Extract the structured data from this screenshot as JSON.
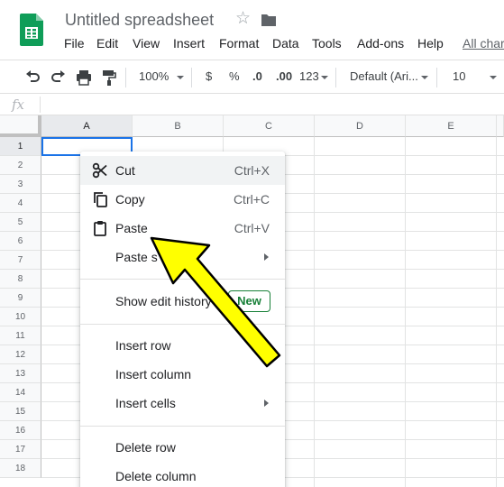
{
  "app": {
    "doc_title": "Untitled spreadsheet",
    "last_edit": "All char"
  },
  "menubar": [
    {
      "label": "File"
    },
    {
      "label": "Edit"
    },
    {
      "label": "View"
    },
    {
      "label": "Insert"
    },
    {
      "label": "Format"
    },
    {
      "label": "Data"
    },
    {
      "label": "Tools"
    },
    {
      "label": "Add-ons"
    },
    {
      "label": "Help"
    }
  ],
  "toolbar": {
    "zoom": "100%",
    "currency": "$",
    "percent": "%",
    "decrease_decimals": ".0",
    "increase_decimals": ".00",
    "more_formats": "123",
    "font": "Default (Ari...",
    "font_size": "10"
  },
  "formula_bar": {
    "fx": "fx"
  },
  "grid": {
    "columns": [
      "A",
      "B",
      "C",
      "D",
      "E"
    ],
    "rows": [
      "1",
      "2",
      "3",
      "4",
      "5",
      "6",
      "7",
      "8",
      "9",
      "10",
      "11",
      "12",
      "13",
      "14",
      "15",
      "16",
      "17",
      "18"
    ],
    "selected": "A1"
  },
  "context_menu": {
    "cut": {
      "label": "Cut",
      "shortcut": "Ctrl+X"
    },
    "copy": {
      "label": "Copy",
      "shortcut": "Ctrl+C"
    },
    "paste": {
      "label": "Paste",
      "shortcut": "Ctrl+V"
    },
    "paste_special": {
      "label": "Paste s"
    },
    "show_edit_history": {
      "label": "Show edit history",
      "badge": "New"
    },
    "insert_row": {
      "label": "Insert row"
    },
    "insert_column": {
      "label": "Insert column"
    },
    "insert_cells": {
      "label": "Insert cells"
    },
    "delete_row": {
      "label": "Delete row"
    },
    "delete_column": {
      "label": "Delete column"
    }
  },
  "colors": {
    "sheets_green": "#0f9d58",
    "selection_blue": "#1a73e8",
    "badge_green": "#188038",
    "arrow_yellow": "#ffff00"
  },
  "icons": [
    "sheets-logo-icon",
    "star-icon",
    "folder-icon",
    "undo-icon",
    "redo-icon",
    "print-icon",
    "paint-format-icon",
    "scissors-icon",
    "copy-icon",
    "clipboard-icon"
  ]
}
